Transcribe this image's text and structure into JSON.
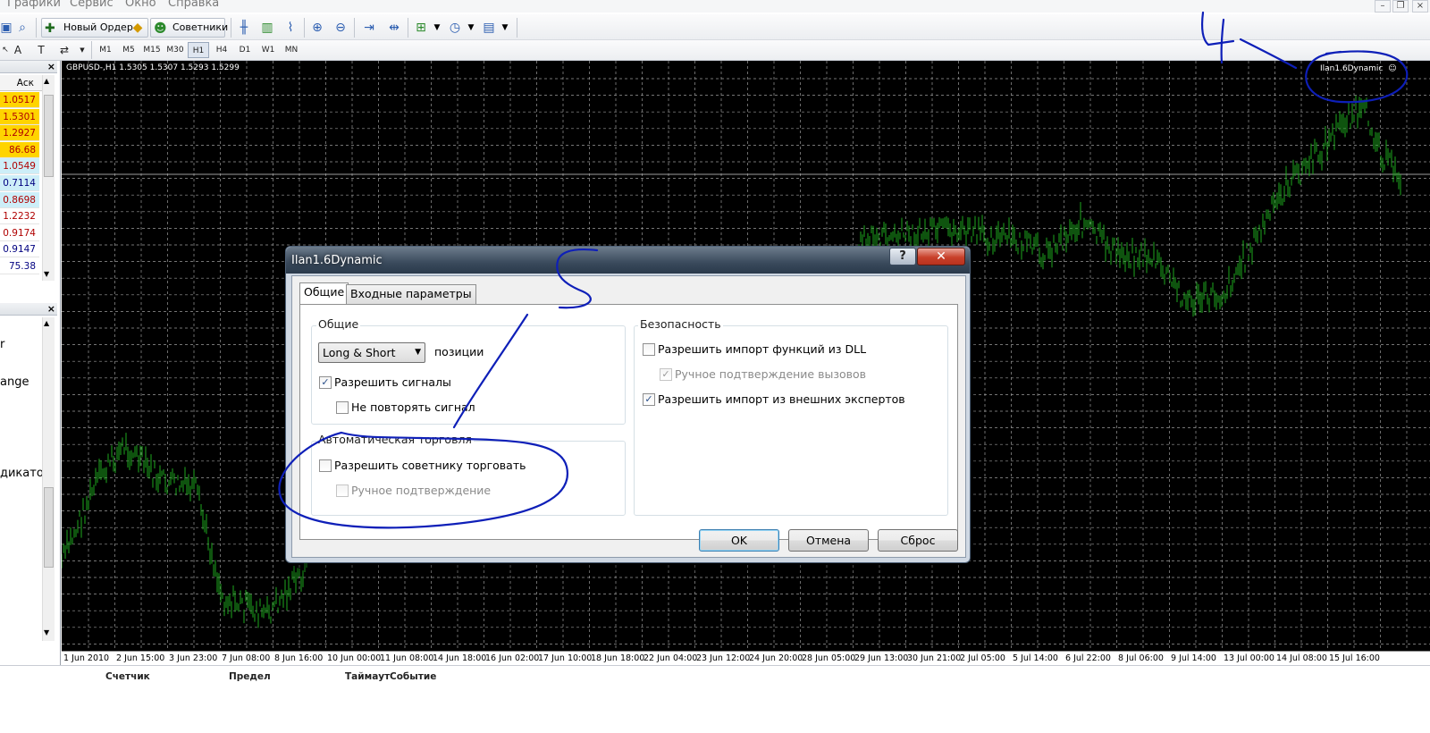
{
  "menu": [
    "Графики",
    "Сервис",
    "Окно",
    "Справка"
  ],
  "toolbar": {
    "new_order": "Новый Ордер",
    "experts": "Советники",
    "timeframes": [
      "M1",
      "M5",
      "M15",
      "M30",
      "H1",
      "H4",
      "D1",
      "W1",
      "MN"
    ],
    "active_timeframe": "H1"
  },
  "market_watch": {
    "header_ask": "Аск",
    "quotes": [
      {
        "value": "1.0517",
        "bg": "#ffd400",
        "color": "#b00000"
      },
      {
        "value": "1.5301",
        "bg": "#ffd400",
        "color": "#b00000"
      },
      {
        "value": "1.2927",
        "bg": "#ffd400",
        "color": "#b00000"
      },
      {
        "value": "86.68",
        "bg": "#ffd400",
        "color": "#b00000"
      },
      {
        "value": "1.0549",
        "bg": "#cdeef8",
        "color": "#b00000"
      },
      {
        "value": "0.7114",
        "bg": "#cdeef8",
        "color": "#000080"
      },
      {
        "value": "0.8698",
        "bg": "#cdeef8",
        "color": "#b00000"
      },
      {
        "value": "1.2232",
        "bg": "#ffffff",
        "color": "#b00000"
      },
      {
        "value": "0.9174",
        "bg": "#ffffff",
        "color": "#b00000"
      },
      {
        "value": "0.9147",
        "bg": "#ffffff",
        "color": "#000080"
      },
      {
        "value": "75.38",
        "bg": "#ffffff",
        "color": "#000080"
      }
    ]
  },
  "navigator": {
    "items": [
      "r",
      "ange",
      "дикато"
    ]
  },
  "chart": {
    "info": "GBPUSD-,H1  1.5305 1.5307 1.5293 1.5299",
    "expert_label": "Ilan1.6Dynamic",
    "x_labels": [
      "1 Jun 2010",
      "2 Jun 15:00",
      "3 Jun 23:00",
      "7 Jun 08:00",
      "8 Jun 16:00",
      "10 Jun 00:00",
      "11 Jun 08:00",
      "14 Jun 18:00",
      "16 Jun 02:00",
      "17 Jun 10:00",
      "18 Jun 18:00",
      "22 Jun 04:00",
      "23 Jun 12:00",
      "24 Jun 20:00",
      "28 Jun 05:00",
      "29 Jun 13:00",
      "30 Jun 21:00",
      "2 Jul 05:00",
      "5 Jul 14:00",
      "6 Jul 22:00",
      "8 Jul 06:00",
      "9 Jul 14:00",
      "13 Jul 00:00",
      "14 Jul 08:00",
      "15 Jul 16:00"
    ]
  },
  "terminal": {
    "columns": [
      "Счетчик",
      "Предел",
      "Таймаут",
      "Событие"
    ]
  },
  "dialog": {
    "title": "Ilan1.6Dynamic",
    "help": "?",
    "close": "✕",
    "tabs": [
      "Общие",
      "Входные параметры"
    ],
    "general": {
      "group_label": "Общие",
      "positions_value": "Long & Short",
      "positions_label": "позиции",
      "allow_signals": {
        "label": "Разрешить сигналы",
        "checked": true
      },
      "no_repeat": {
        "label": "Не повторять сигнал",
        "checked": false
      }
    },
    "auto_trading": {
      "group_label": "Автоматическая торговля",
      "allow_trade": {
        "label": "Разрешить советнику торговать",
        "checked": false
      },
      "manual_confirm": {
        "label": "Ручное подтверждение",
        "checked": false,
        "disabled": true
      }
    },
    "safety": {
      "group_label": "Безопасность",
      "allow_dll": {
        "label": "Разрешить импорт функций из DLL",
        "checked": false
      },
      "manual_calls": {
        "label": "Ручное подтверждение вызовов",
        "checked": true,
        "disabled": true
      },
      "allow_external": {
        "label": "Разрешить импорт из внешних экспертов",
        "checked": true
      }
    },
    "buttons": {
      "ok": "OK",
      "cancel": "Отмена",
      "reset": "Сброс"
    }
  },
  "annotations": {
    "number_4": "4",
    "number_5": "5"
  }
}
